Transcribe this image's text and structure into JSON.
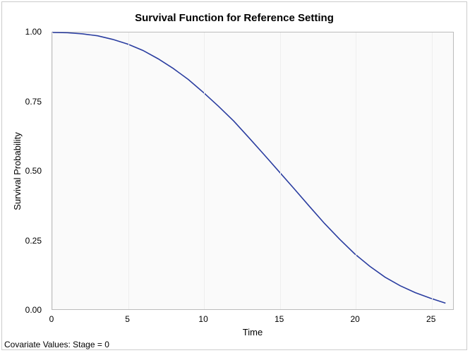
{
  "chart_data": {
    "type": "line",
    "title": "Survival Function for Reference Setting",
    "xlabel": "Time",
    "ylabel": "Survival Probability",
    "footnote": "Covariate Values: Stage = 0",
    "xlim": [
      0,
      26.5
    ],
    "ylim": [
      0.0,
      1.0
    ],
    "xticks": [
      0,
      5,
      10,
      15,
      20,
      25
    ],
    "yticks": [
      0.0,
      0.25,
      0.5,
      0.75,
      1.0
    ],
    "xtick_labels": [
      "0",
      "5",
      "10",
      "15",
      "20",
      "25"
    ],
    "ytick_labels": [
      "0.00",
      "0.25",
      "0.50",
      "0.75",
      "1.00"
    ],
    "series": [
      {
        "name": "Survival",
        "color": "#2a3da0",
        "x": [
          0,
          1,
          2,
          3,
          4,
          5,
          6,
          7,
          8,
          9,
          10,
          11,
          12,
          13,
          14,
          15,
          16,
          17,
          18,
          19,
          20,
          21,
          22,
          23,
          24,
          25,
          26
        ],
        "y": [
          1.0,
          0.999,
          0.995,
          0.988,
          0.975,
          0.958,
          0.935,
          0.905,
          0.87,
          0.83,
          0.783,
          0.733,
          0.68,
          0.62,
          0.559,
          0.497,
          0.435,
          0.372,
          0.31,
          0.253,
          0.2,
          0.155,
          0.116,
          0.085,
          0.06,
          0.04,
          0.022
        ]
      }
    ]
  }
}
